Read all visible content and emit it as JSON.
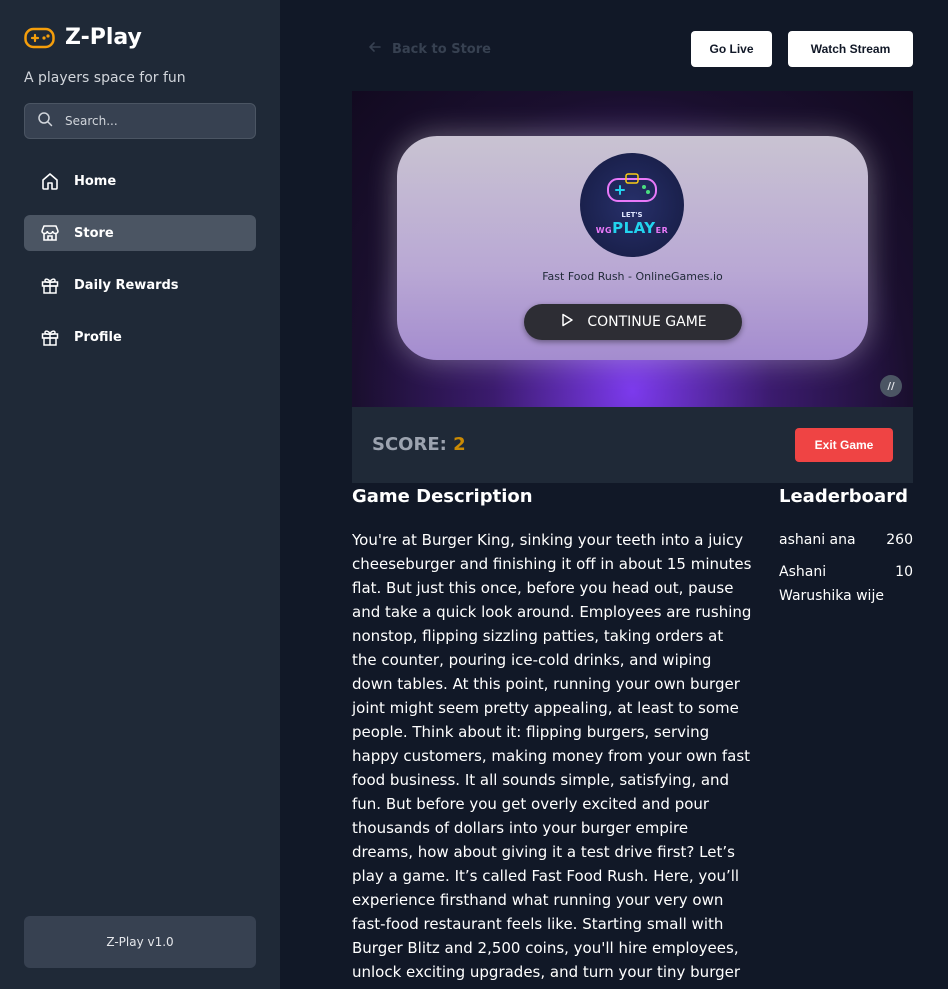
{
  "sidebar": {
    "brand": "Z-Play",
    "tagline": "A players space for fun",
    "search_placeholder": "Search...",
    "items": [
      {
        "label": "Home",
        "icon": "home-icon"
      },
      {
        "label": "Store",
        "icon": "store-icon",
        "active": true
      },
      {
        "label": "Daily Rewards",
        "icon": "gift-icon"
      },
      {
        "label": "Profile",
        "icon": "gift-icon"
      }
    ],
    "version": "Z-Play v1.0"
  },
  "header": {
    "back_label": "Back to Store",
    "go_live": "Go Live",
    "watch_stream": "Watch Stream"
  },
  "game": {
    "logo_top": "LET'S",
    "logo_main": "PLAY",
    "logo_prefix": "WG",
    "logo_suffix": "ER",
    "subtitle": "Fast Food Rush - OnlineGames.io",
    "continue_label": "CONTINUE GAME",
    "badge": "//"
  },
  "score": {
    "label": "SCORE:",
    "value": "2",
    "exit_label": "Exit Game"
  },
  "description": {
    "title": "Game Description",
    "text": "You're at Burger King, sinking your teeth into a juicy cheeseburger and finishing it off in about 15 minutes flat. But just this once, before you head out, pause and take a quick look around. Employees are rushing nonstop, flipping sizzling patties, taking orders at the counter, pouring ice-cold drinks, and wiping down tables. At this point, running your own burger joint might seem pretty appealing, at least to some people. Think about it: flipping burgers, serving happy customers, making money from your own fast food business. It all sounds simple, satisfying, and fun. But before you get overly excited and pour thousands of dollars into your burger empire dreams, how about giving it a test drive first? Let’s play a game. It’s called Fast Food Rush. Here, you’ll experience firsthand what running your very own fast-food restaurant feels like. Starting small with Burger Blitz and 2,500 coins, you'll hire employees, unlock exciting upgrades, and turn your tiny burger stand into a full-on fast-food empire"
  },
  "leaderboard": {
    "title": "Leaderboard",
    "entries": [
      {
        "name": "ashani ana",
        "score": "260"
      },
      {
        "name": "Ashani Warushika wije",
        "score": "10"
      }
    ]
  },
  "colors": {
    "background": "#111827",
    "sidebar": "#1f2937",
    "brand_icon": "#f59e0b",
    "score_value": "#ca8a04",
    "exit_button": "#ef4444"
  }
}
